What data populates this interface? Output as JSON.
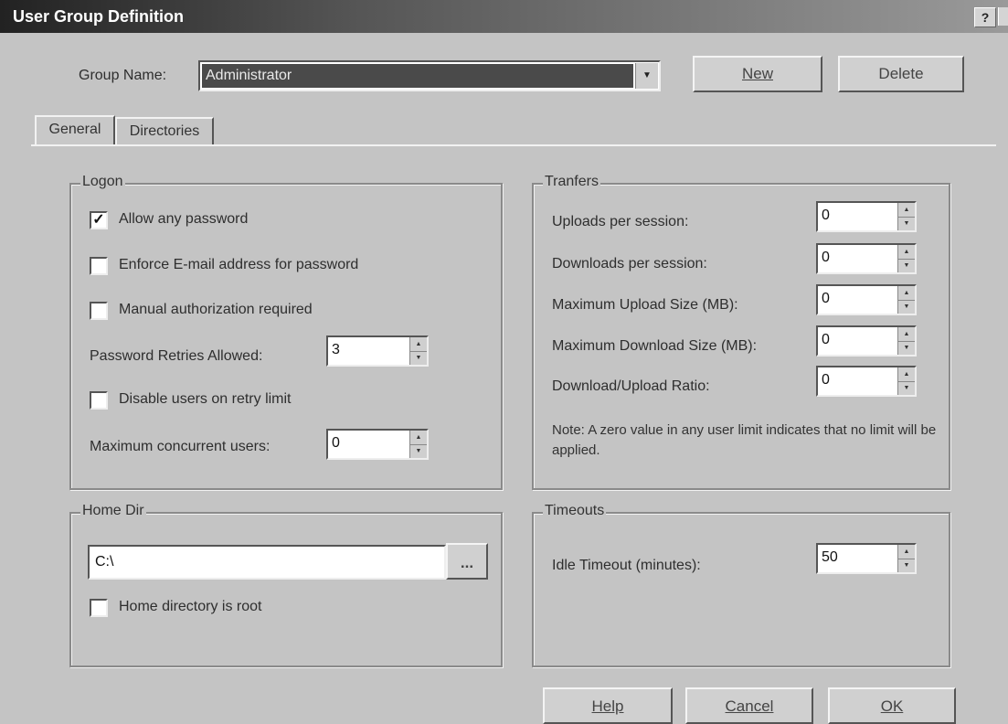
{
  "window": {
    "title": "User Group Definition",
    "help_label": "?"
  },
  "header": {
    "group_name_label": "Group Name:",
    "group_name_value": "Administrator",
    "new_label": "New",
    "delete_label": "Delete"
  },
  "tabs": [
    {
      "label": "General",
      "active": true
    },
    {
      "label": "Directories",
      "active": false
    }
  ],
  "logon": {
    "title": "Logon",
    "allow_any_password": {
      "label": "Allow any password",
      "checked": true,
      "mark": "✓"
    },
    "enforce_email": {
      "label": "Enforce E-mail address for password",
      "checked": false
    },
    "manual_auth": {
      "label": "Manual authorization required",
      "checked": false
    },
    "password_retries": {
      "label": "Password Retries Allowed:",
      "value": "3"
    },
    "disable_users": {
      "label": "Disable users on retry limit",
      "checked": false
    },
    "max_concurrent": {
      "label": "Maximum concurrent users:",
      "value": "0"
    }
  },
  "transfers": {
    "title": "Tranfers",
    "uploads_per_session": {
      "label": "Uploads per session:",
      "value": "0"
    },
    "downloads_per_session": {
      "label": "Downloads per session:",
      "value": "0"
    },
    "max_upload_size": {
      "label": "Maximum Upload Size (MB):",
      "value": "0"
    },
    "max_download_size": {
      "label": "Maximum Download Size (MB):",
      "value": "0"
    },
    "ratio": {
      "label": "Download/Upload Ratio:",
      "value": "0"
    },
    "note": "Note: A zero value in any user limit indicates that no limit will be applied."
  },
  "home_dir": {
    "title": "Home Dir",
    "path": "C:\\",
    "browse_label": "...",
    "home_is_root": {
      "label": "Home directory is root",
      "checked": false
    }
  },
  "timeouts": {
    "title": "Timeouts",
    "idle_timeout": {
      "label": "Idle Timeout (minutes):",
      "value": "50"
    }
  },
  "footer": {
    "help_label": "Help",
    "cancel_label": "Cancel",
    "ok_label": "OK"
  }
}
